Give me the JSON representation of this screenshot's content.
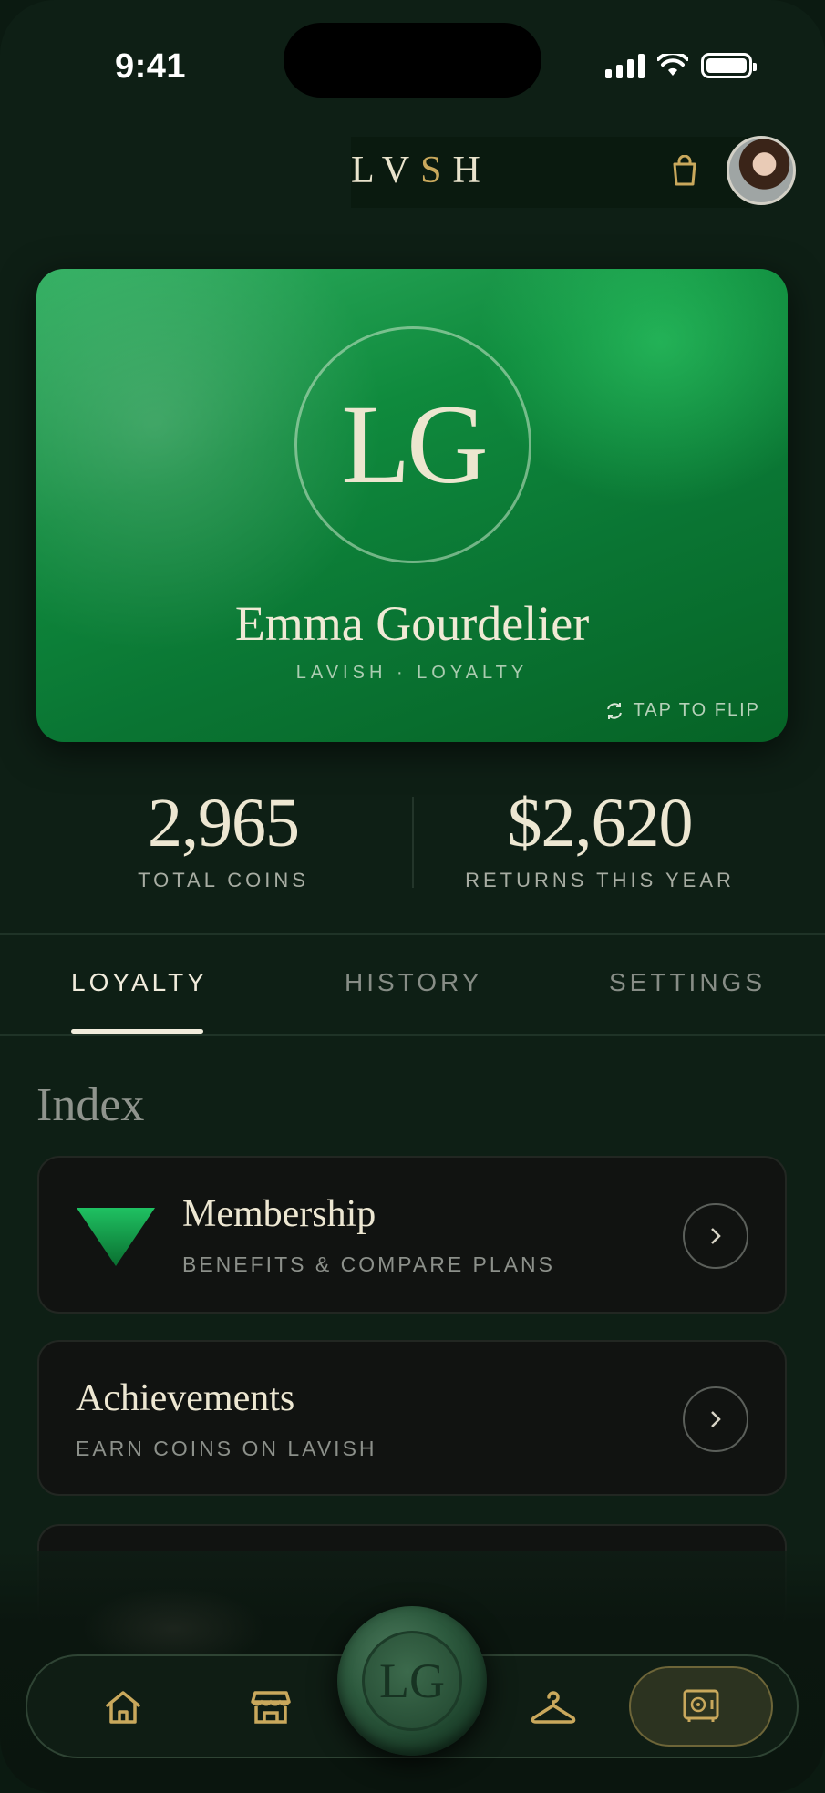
{
  "status_bar": {
    "time": "9:41"
  },
  "header": {
    "logo_prefix": "LV",
    "logo_accent": "S",
    "logo_suffix": "H",
    "icons": [
      "shopping-bag-icon",
      "avatar"
    ]
  },
  "card": {
    "monogram": "LG",
    "name": "Emma Gourdelier",
    "subtitle": "LAVISH · LOYALTY",
    "flip_hint": "TAP TO FLIP"
  },
  "stats": [
    {
      "value": "2,965",
      "label": "TOTAL COINS"
    },
    {
      "value": "$2,620",
      "label": "RETURNS THIS YEAR"
    }
  ],
  "tabs": [
    {
      "label": "LOYALTY",
      "active": true
    },
    {
      "label": "HISTORY",
      "active": false
    },
    {
      "label": "SETTINGS",
      "active": false
    }
  ],
  "section": {
    "title": "Index"
  },
  "items": [
    {
      "title": "Membership",
      "subtitle": "BENEFITS & COMPARE PLANS"
    },
    {
      "title": "Achievements",
      "subtitle": "EARN COINS ON LAVISH"
    }
  ],
  "bottom_nav": {
    "items": [
      "home-icon",
      "store-icon",
      "wax-seal",
      "hanger-icon",
      "vault-icon"
    ],
    "seal_monogram": "LG",
    "active": "vault-icon"
  },
  "colors": {
    "background": "#0e1f15",
    "card_green": "#0f8a3d",
    "gold": "#c9a85c",
    "text": "#ece7d6"
  }
}
